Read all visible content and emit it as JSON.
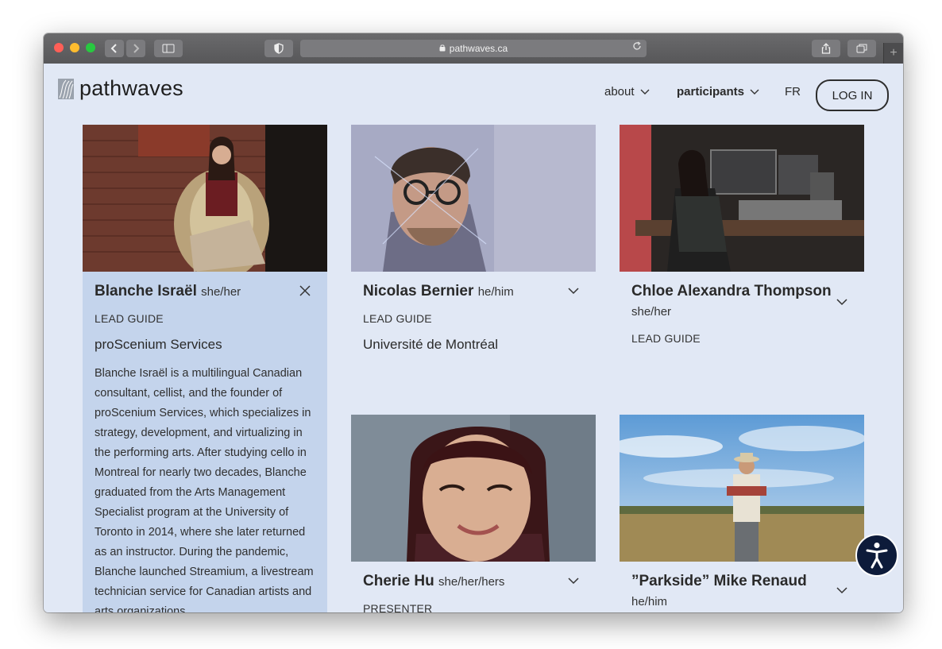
{
  "browser": {
    "url": "pathwaves.ca",
    "lock_icon": "lock-icon",
    "reload_icon": "reload-icon",
    "newtab_label": "+"
  },
  "site": {
    "logo_text": "pathwaves",
    "nav": {
      "about": "about",
      "participants": "participants",
      "lang": "FR",
      "login": "LOG IN"
    }
  },
  "cards": [
    {
      "name": "Blanche Israël",
      "pronouns": "she/her",
      "role": "LEAD GUIDE",
      "org": "proScenium Services",
      "bio": "Blanche Israël is a multilingual Canadian consultant, cellist, and the founder of proScenium Services, which specializes in strategy, development, and virtualizing in the performing arts. After studying cello in Montreal for nearly two decades, Blanche graduated from the Arts Management Specialist program at the University of Toronto in 2014, where she later returned as an instructor. During the pandemic, Blanche launched Streamium, a livestream technician service for Canadian artists and arts organizations.",
      "expanded": true
    },
    {
      "name": "Nicolas Bernier",
      "pronouns": "he/him",
      "role": "LEAD GUIDE",
      "org": "Université de Montréal",
      "expanded": false
    },
    {
      "name": "Chloe Alexandra Thompson",
      "pronouns": "she/her",
      "role": "LEAD GUIDE",
      "org": "",
      "expanded": false
    },
    {
      "name": "Cherie Hu",
      "pronouns": "she/her/hers",
      "role": "PRESENTER",
      "expanded": false
    },
    {
      "name": "”Parkside” Mike Renaud",
      "pronouns": "he/him",
      "expanded": false
    }
  ],
  "accessibility_icon": "accessibility-icon",
  "colors": {
    "page_bg": "#e1e8f5",
    "expanded_card_bg": "#c4d4ec",
    "a11y_bg": "#0d1b3a"
  }
}
